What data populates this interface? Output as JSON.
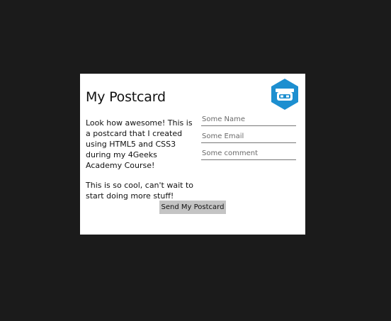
{
  "postcard": {
    "title": "My Postcard",
    "logo_icon": "4geeks-robot-hexagon-icon",
    "logo_color": "#1d8fd0",
    "message": {
      "paragraph1": "Look how awesome! This is a postcard that I created using HTML5 and CSS3 during my 4Geeks Academy Course!",
      "paragraph2": "This is so cool, can't wait to start doing more stuff!"
    },
    "form": {
      "name_placeholder": "Some Name",
      "email_placeholder": "Some Email",
      "comment_placeholder": "Some comment",
      "send_label": "Send My Postcard"
    }
  },
  "colors": {
    "page_background": "#1b1b1b",
    "card_background": "#ffffff",
    "button_background": "#c4c4c4"
  }
}
